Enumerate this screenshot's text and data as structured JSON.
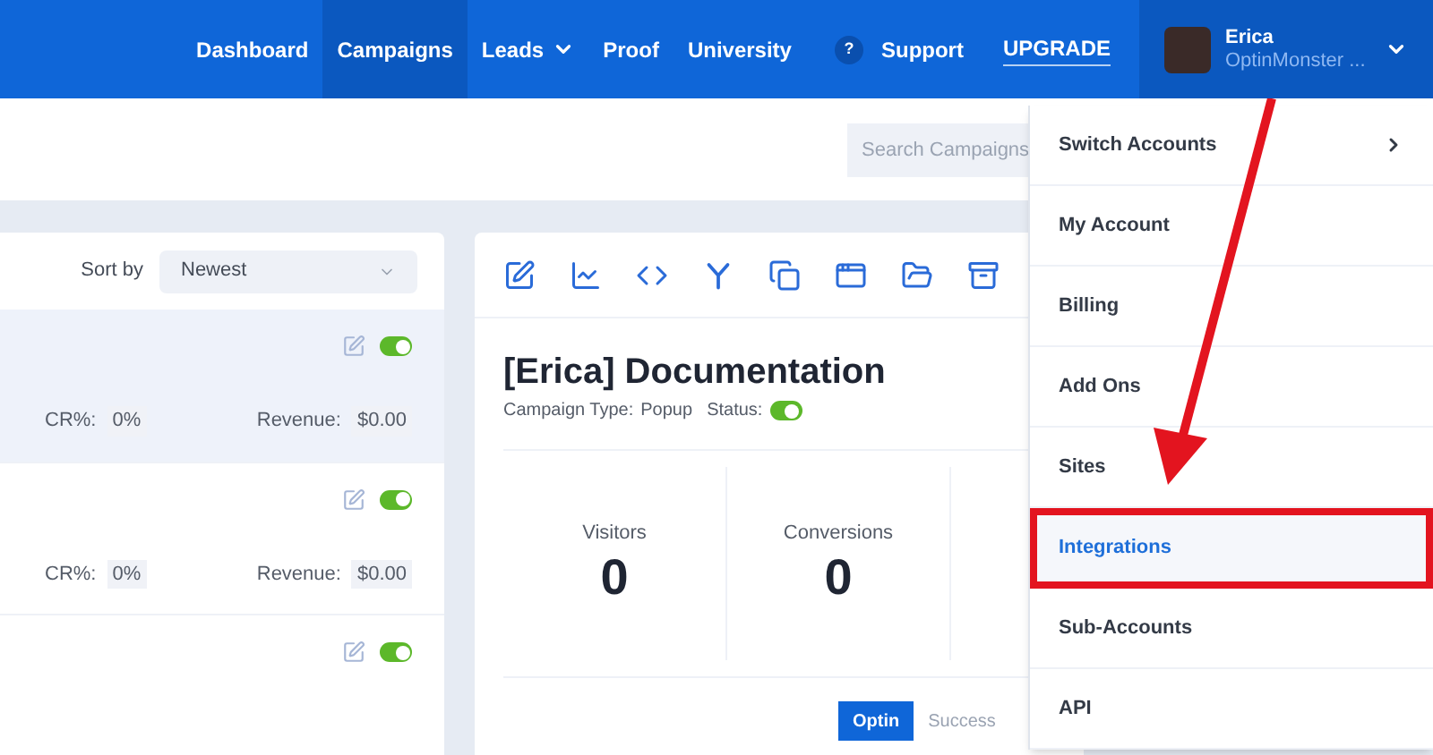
{
  "nav": {
    "items": [
      {
        "label": "Dashboard",
        "kind": "link",
        "selected": false
      },
      {
        "label": "Campaigns",
        "kind": "link",
        "selected": true
      },
      {
        "label": "Leads",
        "kind": "dropdown",
        "selected": false
      },
      {
        "label": "Proof",
        "kind": "link",
        "selected": false
      },
      {
        "label": "University",
        "kind": "link",
        "selected": false
      },
      {
        "label": "Support",
        "kind": "help",
        "selected": false,
        "icon_text": "?"
      },
      {
        "label": "UPGRADE",
        "kind": "upgrade",
        "selected": false
      }
    ],
    "user": {
      "name": "Erica",
      "account": "OptinMonster ..."
    }
  },
  "search": {
    "placeholder": "Search Campaigns"
  },
  "campaign_list": {
    "sort_label": "Sort by",
    "sort_value": "Newest",
    "rows": [
      {
        "selected": true,
        "enabled": true,
        "cr_label": "CR%:",
        "cr": "0%",
        "revenue_label": "Revenue:",
        "revenue": "$0.00"
      },
      {
        "selected": false,
        "enabled": true,
        "cr_label": "CR%:",
        "cr": "0%",
        "revenue_label": "Revenue:",
        "revenue": "$0.00"
      },
      {
        "selected": false,
        "enabled": true
      }
    ]
  },
  "campaign": {
    "title": "[Erica] Documentation",
    "type_label": "Campaign Type:",
    "type": "Popup",
    "status_label": "Status:",
    "status_on": true,
    "stats": [
      {
        "label": "Visitors",
        "value": "0"
      },
      {
        "label": "Conversions",
        "value": "0"
      }
    ],
    "view_tabs": [
      {
        "label": "Optin",
        "selected": true
      },
      {
        "label": "Success",
        "selected": false
      }
    ]
  },
  "account_menu": {
    "items": [
      {
        "label": "Switch Accounts",
        "has_submenu": true,
        "selected": false
      },
      {
        "label": "My Account",
        "has_submenu": false,
        "selected": false
      },
      {
        "label": "Billing",
        "has_submenu": false,
        "selected": false
      },
      {
        "label": "Add Ons",
        "has_submenu": false,
        "selected": false
      },
      {
        "label": "Sites",
        "has_submenu": false,
        "selected": false
      },
      {
        "label": "Integrations",
        "has_submenu": false,
        "selected": true
      },
      {
        "label": "Sub-Accounts",
        "has_submenu": false,
        "selected": false
      },
      {
        "label": "API",
        "has_submenu": false,
        "selected": false
      }
    ]
  }
}
